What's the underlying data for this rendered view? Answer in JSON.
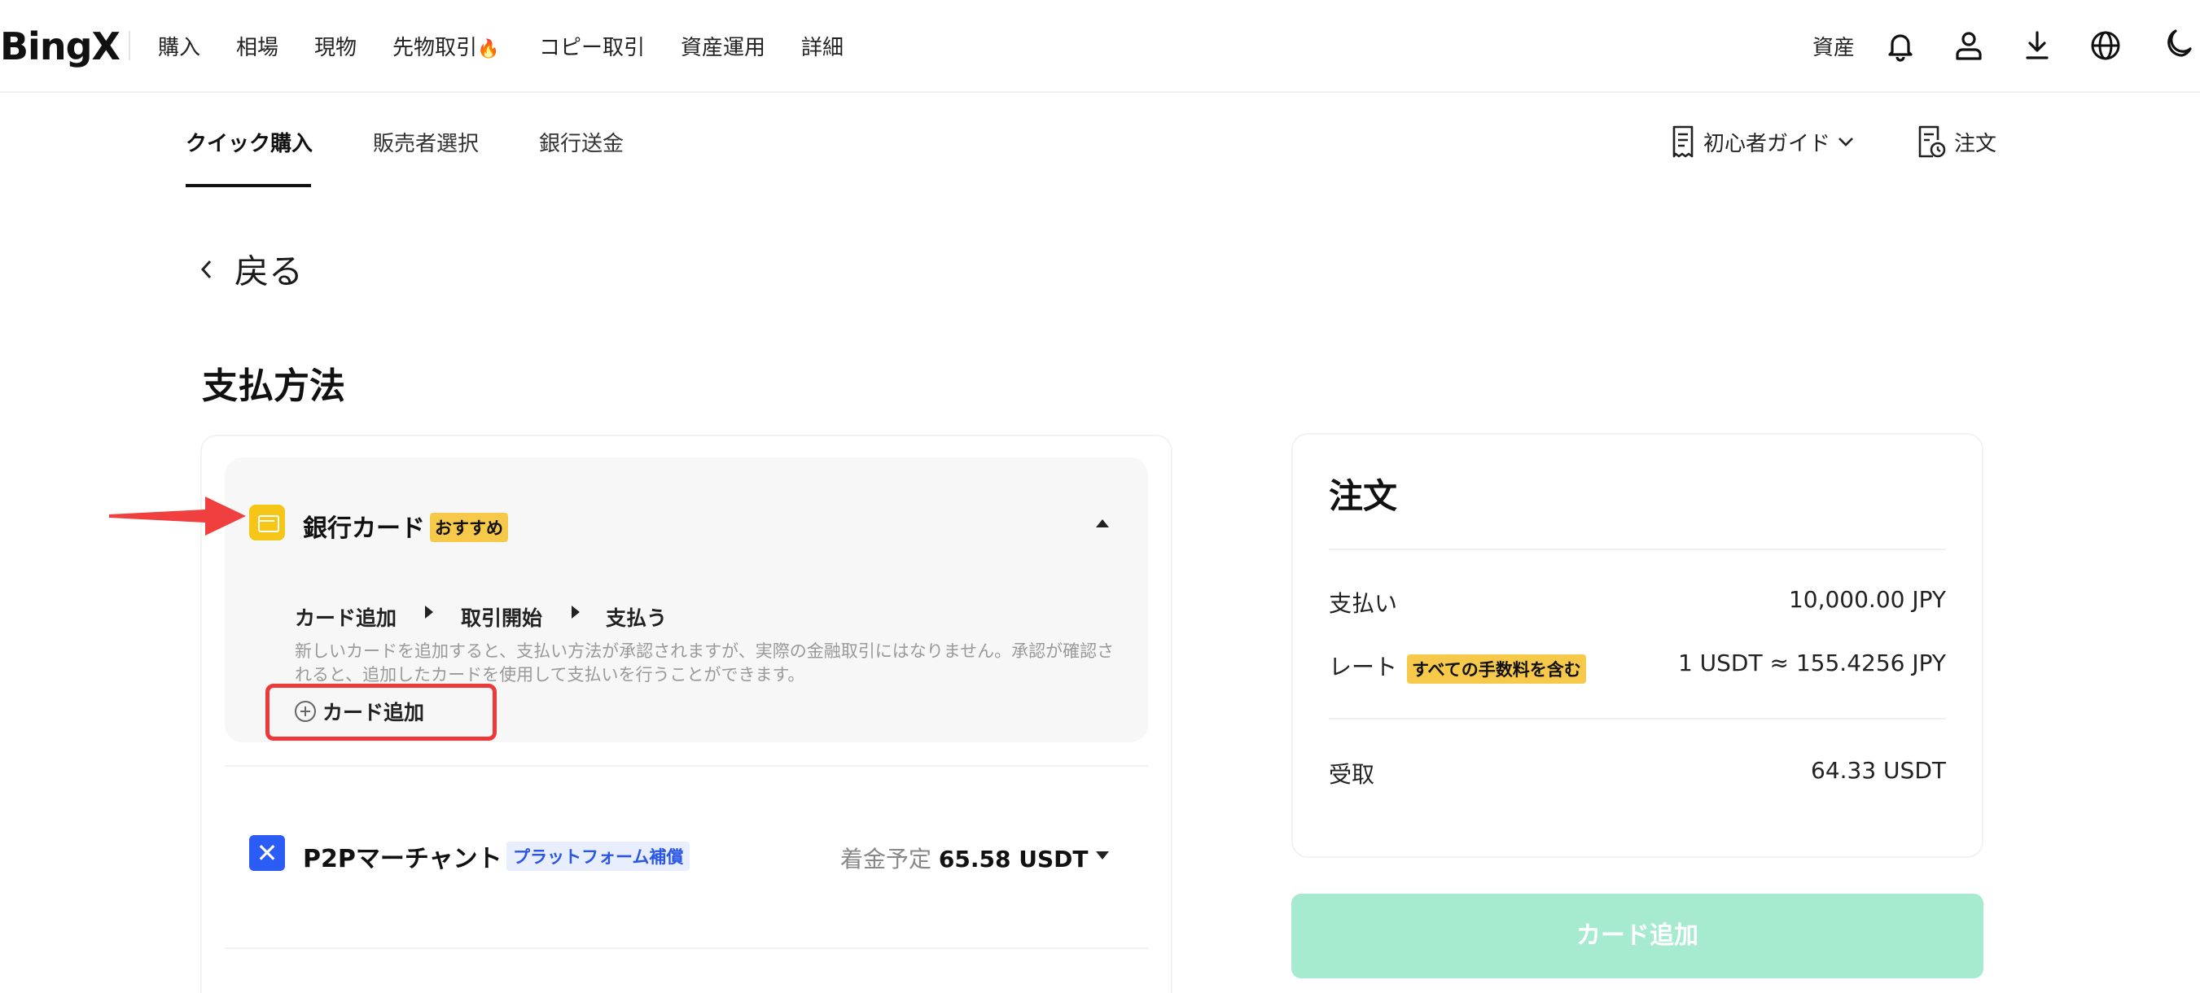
{
  "brand": {
    "logo_text": "BingX"
  },
  "nav": {
    "items": [
      "購入",
      "相場",
      "現物",
      "先物取引",
      "コピー取引",
      "資産運用",
      "詳細"
    ],
    "fire_glyph": "🔥",
    "assets_label": "資産",
    "icons": [
      "bell-icon",
      "user-icon",
      "download-icon",
      "globe-icon",
      "moon-icon"
    ]
  },
  "subnav": {
    "tabs": [
      "クイック購入",
      "販売者選択",
      "銀行送金"
    ],
    "active_tab": "クイック購入",
    "guide_label": "初心者ガイド",
    "orders_label": "注文"
  },
  "back_label": "戻る",
  "page_title": "支払方法",
  "bank_card": {
    "title": "銀行カード",
    "badge": "おすすめ",
    "steps": [
      "カード追加",
      "取引開始",
      "支払う"
    ],
    "description": "新しいカードを追加すると、支払い方法が承認されますが、実際の金融取引にはなりません。承認が確認されると、追加したカードを使用して支払いを行うことができます。",
    "add_card_label": "カード追加"
  },
  "p2p": {
    "title": "P2Pマーチャント",
    "badge": "プラットフォーム補償",
    "eta_label": "着金予定",
    "eta_value": "65.58 USDT"
  },
  "order": {
    "title": "注文",
    "pay_label": "支払い",
    "pay_value": "10,000.00 JPY",
    "rate_label": "レート",
    "rate_badge": "すべての手数料を含む",
    "rate_value": "1 USDT ≈ 155.4256 JPY",
    "receive_label": "受取",
    "receive_value": "64.33 USDT"
  },
  "cta_label": "カード追加",
  "colors": {
    "accent_yellow": "#f7c94b",
    "p2p_blue": "#2b5cf5",
    "cta_green": "#a6ebcf",
    "annotation_red": "#ec3a3a"
  }
}
